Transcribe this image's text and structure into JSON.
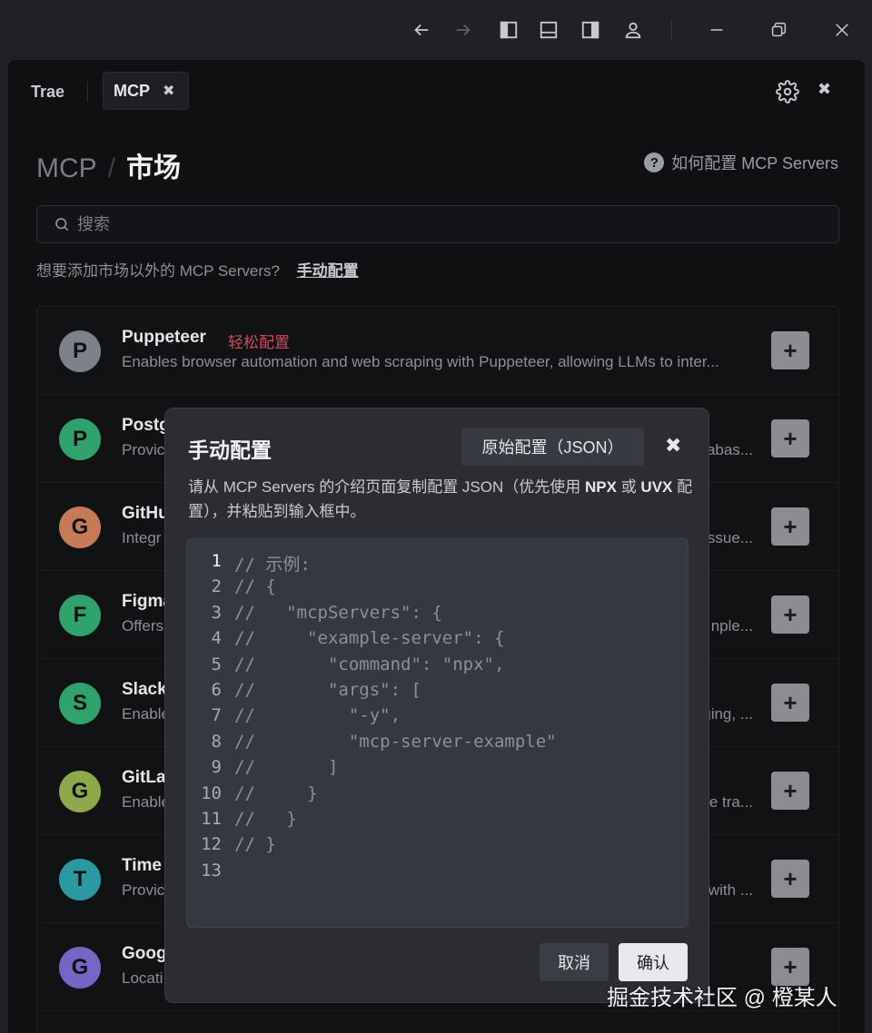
{
  "titlebar": {
    "icons": [
      "back-arrow-icon",
      "forward-arrow-icon",
      "panel-left-icon",
      "panel-bottom-icon",
      "panel-right-icon",
      "account-icon",
      "minimize-icon",
      "restore-icon",
      "close-icon"
    ]
  },
  "tabs": [
    {
      "label": "Trae"
    },
    {
      "label": "MCP",
      "close": "✖"
    }
  ],
  "window_close": "✖",
  "breadcrumb": {
    "parent": "MCP",
    "separator": "/",
    "current": "市场"
  },
  "help": {
    "icon": "?",
    "label": "如何配置 MCP Servers"
  },
  "search": {
    "placeholder": "搜索"
  },
  "manual_config": {
    "prompt": "想要添加市场以外的 MCP Servers?",
    "link": "手动配置"
  },
  "servers": [
    {
      "initial": "P",
      "color": "#7d818a",
      "name": "Puppeteer",
      "tag": "轻松配置",
      "desc": "Enables browser automation and web scraping with Puppeteer, allowing LLMs to inter...",
      "tail": ""
    },
    {
      "initial": "P",
      "color": "#2fa36b",
      "name": "Postg",
      "tag": "",
      "desc": "Provic",
      "tail": "abas..."
    },
    {
      "initial": "G",
      "color": "#c67a55",
      "name": "GitHu",
      "tag": "",
      "desc": "Integr",
      "tail": "issue..."
    },
    {
      "initial": "F",
      "color": "#2fa36b",
      "name": "Figma",
      "tag": "",
      "desc": "Offers",
      "tail": "nple..."
    },
    {
      "initial": "S",
      "color": "#2fa36b",
      "name": "Slack",
      "tag": "",
      "desc": "Enable",
      "tail": "ging, ..."
    },
    {
      "initial": "G",
      "color": "#8fa94a",
      "name": "GitLal",
      "tag": "",
      "desc": "Enable",
      "tail": "e tra..."
    },
    {
      "initial": "T",
      "color": "#2a9aa0",
      "name": "Time",
      "tag": "",
      "desc": "Provic",
      "tail": "with ..."
    },
    {
      "initial": "G",
      "color": "#7466c4",
      "name": "Goog",
      "tag": "",
      "desc": "Locati",
      "tail": ""
    }
  ],
  "add_label": "+",
  "modal": {
    "title": "手动配置",
    "json_button": "原始配置（JSON）",
    "close": "✖",
    "desc_1": "请从 MCP Servers 的介绍页面复制配置 JSON（优先使用 ",
    "desc_npx": "NPX",
    "desc_or": " 或 ",
    "desc_uvx": "UVX",
    "desc_2": " 配置），并粘贴到输入框中。",
    "code_lines": [
      "// 示例:",
      "// {",
      "//   \"mcpServers\": {",
      "//     \"example-server\": {",
      "//       \"command\": \"npx\",",
      "//       \"args\": [",
      "//         \"-y\",",
      "//         \"mcp-server-example\"",
      "//       ]",
      "//     }",
      "//   }",
      "// }",
      ""
    ],
    "cancel": "取消",
    "confirm": "确认"
  },
  "watermark": "掘金技术社区 @ 橙某人"
}
